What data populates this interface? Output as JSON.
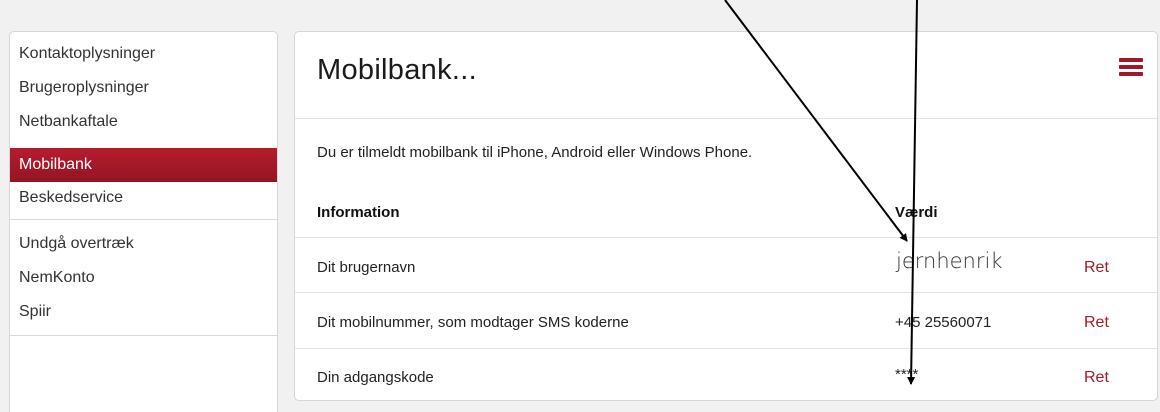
{
  "sidebar": {
    "items": [
      {
        "label": "Kontaktoplysninger"
      },
      {
        "label": "Brugeroplysninger"
      },
      {
        "label": "Netbankaftale"
      },
      {
        "label": "Mobilbank",
        "active": true
      },
      {
        "label": "Beskedservice"
      },
      {
        "label": "Undgå overtræk"
      },
      {
        "label": "NemKonto"
      },
      {
        "label": "Spiir"
      }
    ]
  },
  "panel": {
    "title": "Mobilbank...",
    "menu_icon": "hamburger-menu-icon",
    "intro": "Du er tilmeldt mobilbank til iPhone, Android eller Windows Phone.",
    "table": {
      "headers": [
        "Information",
        "Værdi"
      ],
      "rows": [
        {
          "label": "Dit brugernavn",
          "value": "jernhenrik",
          "action": "Ret"
        },
        {
          "label": "Dit mobilnummer, som modtager SMS koderne",
          "value": "+45 25560071",
          "action": "Ret"
        },
        {
          "label": "Din adgangskode",
          "value": "****",
          "action": "Ret"
        }
      ]
    }
  },
  "colors": {
    "accent": "#a01b2c",
    "active_bg": "#a8192a",
    "page_bg": "#f1f1f1"
  }
}
